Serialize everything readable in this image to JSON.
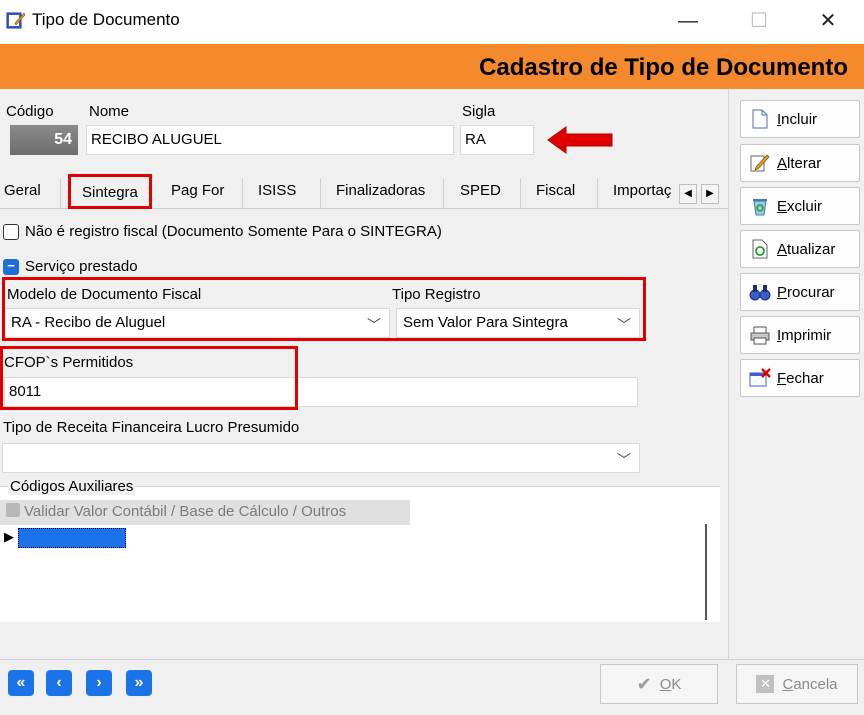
{
  "window": {
    "title": "Tipo de Documento",
    "minimize": "—",
    "maximize": "☐",
    "close": "✕"
  },
  "header": {
    "title": "Cadastro de Tipo de Documento"
  },
  "form": {
    "codigo_label": "Código",
    "codigo_value": "54",
    "nome_label": "Nome",
    "nome_value": "RECIBO ALUGUEL",
    "sigla_label": "Sigla",
    "sigla_value": "RA"
  },
  "tabs": [
    {
      "label": "Geral"
    },
    {
      "label": "Sintegra"
    },
    {
      "label": "Pag For"
    },
    {
      "label": "ISISS"
    },
    {
      "label": "Finalizadoras"
    },
    {
      "label": "SPED"
    },
    {
      "label": "Fiscal"
    },
    {
      "label": "Importaç"
    }
  ],
  "sintegra": {
    "nao_registro_label": "Não é registro fiscal (Documento Somente Para o SINTEGRA)",
    "servico_label": "Serviço prestado",
    "modelo_label": "Modelo de Documento Fiscal",
    "modelo_value": "RA - Recibo de Aluguel",
    "tipo_registro_label": "Tipo Registro",
    "tipo_registro_value": "Sem Valor Para Sintegra",
    "cfop_label": "CFOP`s Permitidos",
    "cfop_value": "8011",
    "tipo_receita_label": "Tipo de Receita Financeira Lucro Presumido",
    "tipo_receita_value": "",
    "auxiliares_label": "Códigos Auxiliares",
    "validar_label": "Validar Valor Contábil / Base de Cálculo / Outros"
  },
  "sidebar": {
    "incluir": {
      "first": "I",
      "rest": "ncluir"
    },
    "alterar": {
      "first": "A",
      "rest": "lterar"
    },
    "excluir": {
      "first": "E",
      "rest": "xcluir"
    },
    "atualizar": {
      "first": "A",
      "rest": "tualizar"
    },
    "procurar": {
      "first": "P",
      "rest": "rocurar"
    },
    "imprimir": {
      "first": "I",
      "rest": "mprimir"
    },
    "fechar": {
      "first": "F",
      "rest": "echar"
    }
  },
  "bottom": {
    "ok": {
      "first": "O",
      "rest": "K"
    },
    "cancela": {
      "first": "C",
      "rest": "ancela"
    }
  },
  "colors": {
    "header": "#f5892e",
    "highlight": "#e10000",
    "nav": "#1a73e8"
  }
}
